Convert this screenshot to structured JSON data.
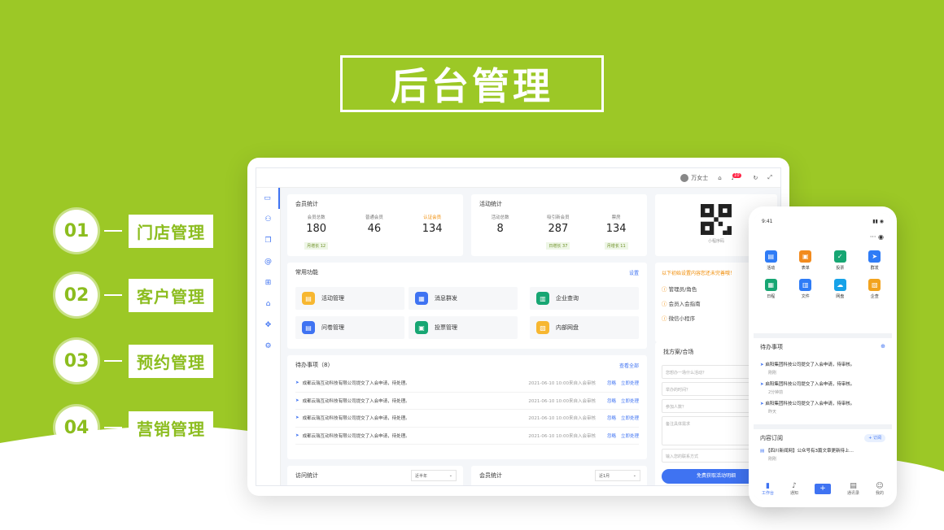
{
  "title": "后台管理",
  "menu": [
    {
      "num": "01",
      "label": "门店管理"
    },
    {
      "num": "02",
      "label": "客户管理"
    },
    {
      "num": "03",
      "label": "预约管理"
    },
    {
      "num": "04",
      "label": "营销管理"
    }
  ],
  "colors": {
    "green": "#9cc826",
    "blue": "#3f73f2",
    "orange": "#f08a00"
  },
  "topbar": {
    "user": "万女士",
    "notif": "10"
  },
  "member_stats": {
    "title": "会员统计",
    "items": [
      {
        "label": "会员总数",
        "value": "180",
        "tag": "月增长 12"
      },
      {
        "label": "普通会员",
        "value": "46"
      },
      {
        "label": "认证会员",
        "value": "134"
      }
    ]
  },
  "activity_stats": {
    "title": "活动统计",
    "items": [
      {
        "label": "活动总数",
        "value": "8"
      },
      {
        "label": "吸引新会员",
        "value": "287",
        "tag": "日增长 37"
      },
      {
        "label": "票房",
        "value": "134",
        "tag": "月增长 11"
      }
    ]
  },
  "qr": {
    "label": "小程序码"
  },
  "functions": {
    "title": "常用功能",
    "settings": "设置",
    "items": [
      "活动管理",
      "消息群发",
      "企业查询",
      "问卷管理",
      "投票管理",
      "内部网盘"
    ]
  },
  "guide": {
    "title": "以下初始设置内容您还未完善哦！",
    "items": [
      "管理员/角色",
      "会员入会指南",
      "微信小程序"
    ]
  },
  "todo": {
    "title": "待办事项（8）",
    "more": "查看全部",
    "items": [
      {
        "msg": "成都云瑞互动科技有限公司提交了入会申请，待处理。",
        "time": "2021-06-10 10:00来自入会审核"
      },
      {
        "msg": "成都云瑞互动科技有限公司提交了入会申请，待处理。",
        "time": "2021-06-10 10:00来自入会审核"
      },
      {
        "msg": "成都云瑞互动科技有限公司提交了入会申请，待处理。",
        "time": "2021-06-10 10:00来自入会审核"
      },
      {
        "msg": "成都云瑞互动科技有限公司提交了入会申请，待处理。",
        "time": "2021-06-10 10:00来自入会审核"
      }
    ],
    "ignore": "忽略",
    "handle": "立即处理"
  },
  "plan": {
    "title": "找方案/合场",
    "inputs": [
      "您想办一场什么活动？",
      "举办的时间？",
      "参加人数？",
      "备注具体需求",
      "输入您的联系方式"
    ],
    "button": "免费获取活动明细"
  },
  "visits": {
    "title": "访问统计",
    "select": "近半年"
  },
  "member_stats2": {
    "title": "会员统计",
    "select": "近1月"
  },
  "phone": {
    "time": "9:41",
    "icons": [
      {
        "label": "活动",
        "color": "#2f7cf6"
      },
      {
        "label": "表单",
        "color": "#f28b1e"
      },
      {
        "label": "投票",
        "color": "#17a673"
      },
      {
        "label": "群发",
        "color": "#2f7cf6"
      },
      {
        "label": "日程",
        "color": "#17a673"
      },
      {
        "label": "文件",
        "color": "#2f7cf6"
      },
      {
        "label": "网盘",
        "color": "#17a2e8"
      },
      {
        "label": "企查",
        "color": "#f2a31e"
      }
    ],
    "todo_title": "待办事项",
    "todos": [
      {
        "msg": "启阳集团科技公司提交了入会申请，待审核。",
        "sub": "刚刚"
      },
      {
        "msg": "启阳集团科技公司提交了入会申请，待审核。",
        "sub": "2分钟前"
      },
      {
        "msg": "启阳集团科技公司提交了入会申请，待审核。",
        "sub": "昨天"
      }
    ],
    "sub_title": "内容订阅",
    "sub_btn": "+ 订阅",
    "sub_msg": "【四川新闻网】公众号有3篇文章更新待上…",
    "sub_time": "刚刚",
    "tabs": [
      "工作台",
      "通知",
      "",
      "通讯录",
      "我的"
    ]
  }
}
